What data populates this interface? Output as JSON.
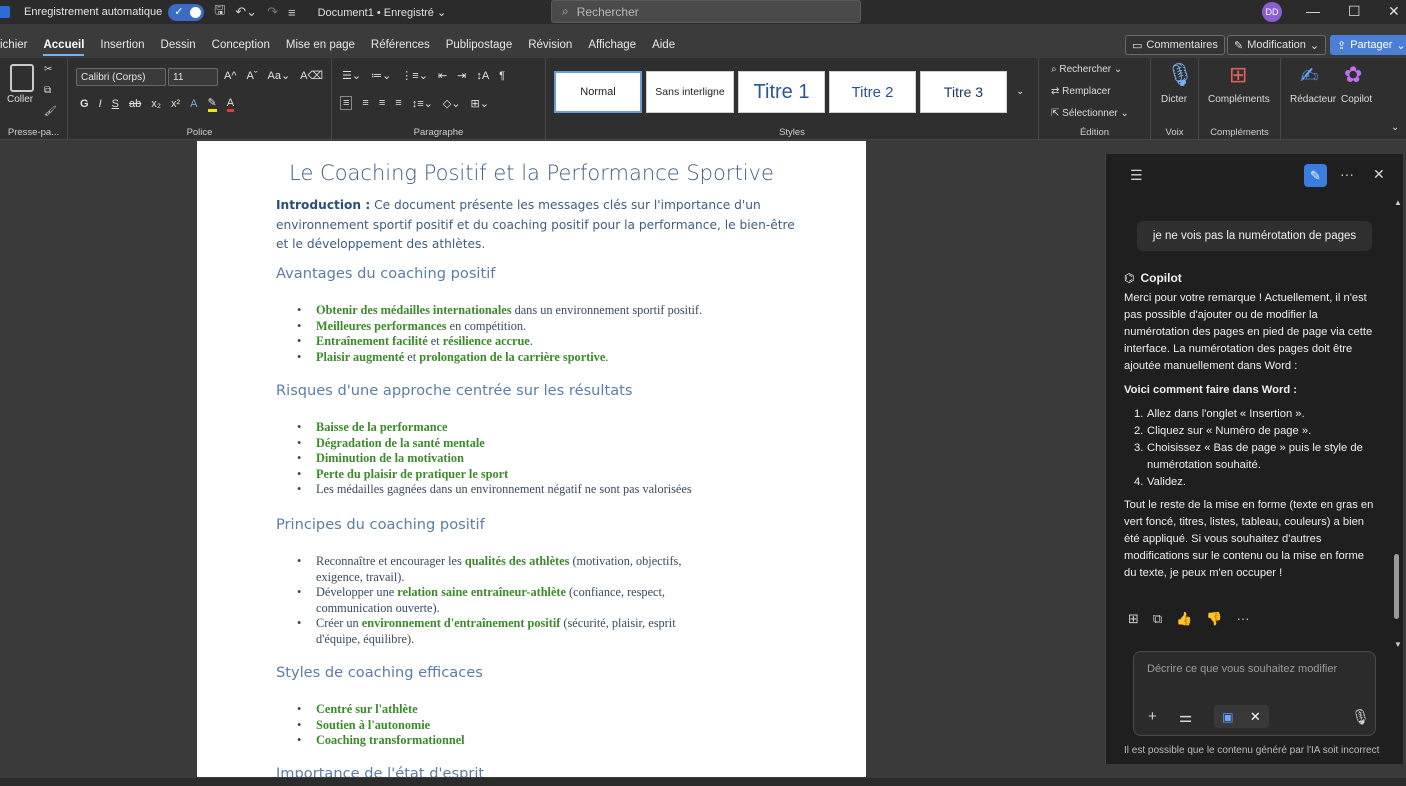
{
  "titlebar": {
    "autosave_label": "Enregistrement automatique",
    "doc_name": "Document1 • Enregistré ⌄",
    "search_placeholder": "Rechercher",
    "avatar_initials": "DD"
  },
  "menu": {
    "tabs": [
      "ichier",
      "Accueil",
      "Insertion",
      "Dessin",
      "Conception",
      "Mise en page",
      "Références",
      "Publipostage",
      "Révision",
      "Affichage",
      "Aide"
    ],
    "active_tab": "Accueil",
    "comments_label": "Commentaires",
    "modification_label": "Modification",
    "share_label": "Partager"
  },
  "ribbon": {
    "paste_label": "Coller",
    "clipboard_group": "Presse-pa...",
    "font_name": "Calibri (Corps)",
    "font_size": "11",
    "font_group": "Police",
    "paragraph_group": "Paragraphe",
    "styles": [
      "Normal",
      "Sans interligne",
      "Titre 1",
      "Titre 2",
      "Titre 3"
    ],
    "styles_group": "Styles",
    "find_label": "Rechercher",
    "replace_label": "Remplacer",
    "select_label": "Sélectionner",
    "editing_group": "Édition",
    "dictate_label": "Dicter",
    "voice_group": "Voix",
    "addins_label": "Compléments",
    "addins_group": "Compléments",
    "editor_label": "Rédacteur",
    "copilot_label": "Copilot"
  },
  "document": {
    "title": "Le Coaching Positif et la Performance Sportive",
    "intro_label": "Introduction :",
    "intro_text": " Ce document présente les messages clés sur l'importance d'un environnement sportif positif et du coaching positif pour la performance, le bien-être et le développement des athlètes.",
    "sections": [
      {
        "heading": "Avantages du coaching positif",
        "items": [
          [
            {
              "t": "Obtenir des médailles internationales",
              "b": true
            },
            {
              "t": " dans un environnement sportif positif.",
              "b": false
            }
          ],
          [
            {
              "t": "Meilleures performances",
              "b": true
            },
            {
              "t": " en compétition.",
              "b": false
            }
          ],
          [
            {
              "t": "Entraînement facilité",
              "b": true
            },
            {
              "t": " et ",
              "b": false
            },
            {
              "t": "résilience accrue",
              "b": true
            },
            {
              "t": ".",
              "b": false
            }
          ],
          [
            {
              "t": "Plaisir augmenté",
              "b": true
            },
            {
              "t": " et ",
              "b": false
            },
            {
              "t": "prolongation de la carrière sportive",
              "b": true
            },
            {
              "t": ".",
              "b": false
            }
          ]
        ]
      },
      {
        "heading": "Risques d'une approche centrée sur les résultats",
        "items": [
          [
            {
              "t": "Baisse de la performance",
              "b": true
            }
          ],
          [
            {
              "t": "Dégradation de la santé mentale",
              "b": true
            }
          ],
          [
            {
              "t": "Diminution de la motivation",
              "b": true
            }
          ],
          [
            {
              "t": "Perte du plaisir de pratiquer le sport",
              "b": true
            }
          ],
          [
            {
              "t": "Les médailles gagnées dans un environnement négatif ne sont pas valorisées",
              "b": false
            }
          ]
        ]
      },
      {
        "heading": "Principes du coaching positif",
        "items": [
          [
            {
              "t": "Reconnaître et encourager les ",
              "b": false
            },
            {
              "t": "qualités des athlètes",
              "b": true
            },
            {
              "t": " (motivation, objectifs, exigence, travail).",
              "b": false
            }
          ],
          [
            {
              "t": "Développer une ",
              "b": false
            },
            {
              "t": "relation saine entraîneur-athlète",
              "b": true
            },
            {
              "t": " (confiance, respect, communication ouverte).",
              "b": false
            }
          ],
          [
            {
              "t": "Créer un ",
              "b": false
            },
            {
              "t": "environnement d'entraînement positif",
              "b": true
            },
            {
              "t": " (sécurité, plaisir, esprit d'équipe, équilibre).",
              "b": false
            }
          ]
        ]
      },
      {
        "heading": "Styles de coaching efficaces",
        "items": [
          [
            {
              "t": "Centré sur l'athlète",
              "b": true
            }
          ],
          [
            {
              "t": "Soutien à l'autonomie",
              "b": true
            }
          ],
          [
            {
              "t": "Coaching transformationnel",
              "b": true
            }
          ]
        ]
      },
      {
        "heading": "Importance de l'état d'esprit",
        "items": []
      }
    ]
  },
  "copilot": {
    "user_message": "je ne vois pas la numérotation de pages",
    "assistant_name": "Copilot",
    "para1": "Merci pour votre remarque ! Actuellement, il n'est pas possible d'ajouter ou de modifier la numérotation des pages en pied de page via cette interface. La numérotation des pages doit être ajoutée manuellement dans Word :",
    "howto_title": "Voici comment faire dans Word :",
    "steps": [
      "Allez dans l'onglet « Insertion ».",
      "Cliquez sur « Numéro de page ».",
      "Choisissez « Bas de page » puis le style de numérotation souhaité.",
      "Validez."
    ],
    "para2": "Tout le reste de la mise en forme (texte en gras en vert foncé, titres, listes, tableau, couleurs) a bien été appliqué. Si vous souhaitez d'autres modifications sur le contenu ou la mise en forme du texte, je peux m'en occuper !",
    "input_placeholder": "Décrire ce que vous souhaitez modifier",
    "disclaimer": "Il est possible que le contenu généré par l'IA soit incorrect"
  },
  "colors": {
    "accent": "#3a7ce0",
    "doc_green": "#3c8a2c",
    "doc_heading": "#5c7ea6"
  }
}
